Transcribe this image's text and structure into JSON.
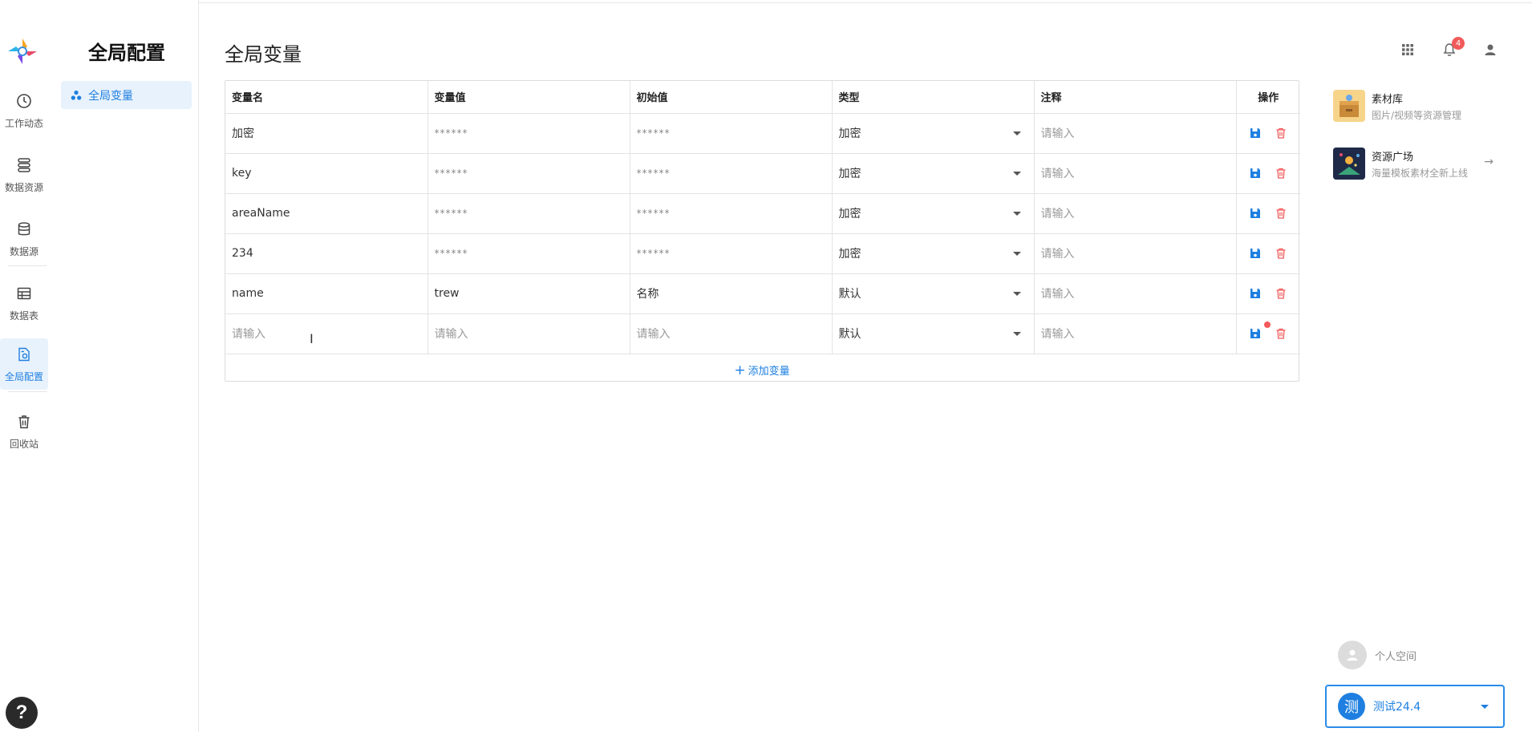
{
  "rail": {
    "items": [
      {
        "label": "工作动态",
        "icon": "clock-icon"
      },
      {
        "label": "数据资源",
        "icon": "database-stack-icon"
      },
      {
        "label": "数据源",
        "icon": "database-icon"
      },
      {
        "label": "数据表",
        "icon": "table-icon"
      },
      {
        "label": "全局配置",
        "icon": "config-file-icon",
        "active": true
      },
      {
        "label": "回收站",
        "icon": "trash-icon"
      }
    ],
    "help": "?"
  },
  "subnav": {
    "title": "全局配置",
    "item": "全局变量"
  },
  "main": {
    "title": "全局变量",
    "table": {
      "headers": [
        "变量名",
        "变量值",
        "初始值",
        "类型",
        "注释",
        "操作"
      ],
      "rows": [
        {
          "name": "加密",
          "value": "******",
          "initial": "******",
          "type": "加密",
          "note": "请输入"
        },
        {
          "name": "key",
          "value": "******",
          "initial": "******",
          "type": "加密",
          "note": "请输入"
        },
        {
          "name": "areaName",
          "value": "******",
          "initial": "******",
          "type": "加密",
          "note": "请输入"
        },
        {
          "name": "234",
          "value": "******",
          "initial": "******",
          "type": "加密",
          "note": "请输入"
        },
        {
          "name": "name",
          "value": "trew",
          "initial": "名称",
          "type": "默认",
          "note": "请输入"
        },
        {
          "name": "请输入",
          "value": "请输入",
          "initial": "请输入",
          "type": "默认",
          "note": "请输入",
          "new": true
        }
      ],
      "add_label": "添加变量"
    }
  },
  "topbar": {
    "notifications": "4"
  },
  "right_panel": {
    "cards": [
      {
        "title": "素材库",
        "subtitle": "图片/视频等资源管理"
      },
      {
        "title": "资源广场",
        "subtitle": "海量模板素材全新上线"
      }
    ],
    "personal": "个人空间",
    "team": {
      "avatar": "测",
      "name": "测试24.4"
    }
  },
  "colors": {
    "accent": "#1e7fe0",
    "danger": "#f25a5a"
  }
}
